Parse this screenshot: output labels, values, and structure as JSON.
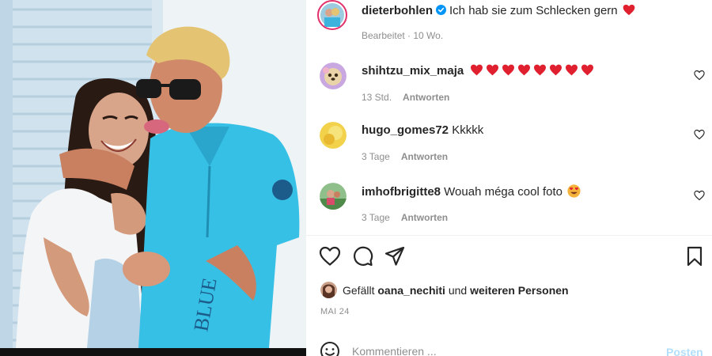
{
  "post": {
    "author": "dieterbohlen",
    "caption_text": "Ich hab sie zum Schlecken gern",
    "caption_emoji": "red-heart",
    "edited_label": "Bearbeitet",
    "age": "10 Wo.",
    "meta_separator": " · "
  },
  "comments": [
    {
      "username": "shihtzu_mix_maja",
      "text": "",
      "emoji": "red-heart x8",
      "time": "13 Std.",
      "reply_label": "Antworten"
    },
    {
      "username": "hugo_gomes72",
      "text": "Kkkkk",
      "time": "3 Tage",
      "reply_label": "Antworten"
    },
    {
      "username": "imhofbrigitte8",
      "text": "Wouah méga cool foto",
      "emoji": "heart-eyes-face",
      "time": "3 Tage",
      "reply_label": "Antworten"
    }
  ],
  "likes": {
    "prefix": "Gefällt",
    "user": "oana_nechiti",
    "joiner": "und",
    "others": "weiteren Personen"
  },
  "date": "MAI 24",
  "comment_input": {
    "placeholder": "Kommentieren ...",
    "post_label": "Posten"
  },
  "icons": {
    "like": "heart-outline-icon",
    "comment": "comment-bubble-icon",
    "share": "paper-plane-icon",
    "save": "bookmark-icon",
    "emoji": "smiley-icon",
    "verified": "verified-badge-icon"
  },
  "colors": {
    "heart_red": "#ed4956",
    "verified_blue": "#0095f6",
    "post_disabled": "#b2dffc",
    "meta_gray": "#8e8e8e"
  }
}
